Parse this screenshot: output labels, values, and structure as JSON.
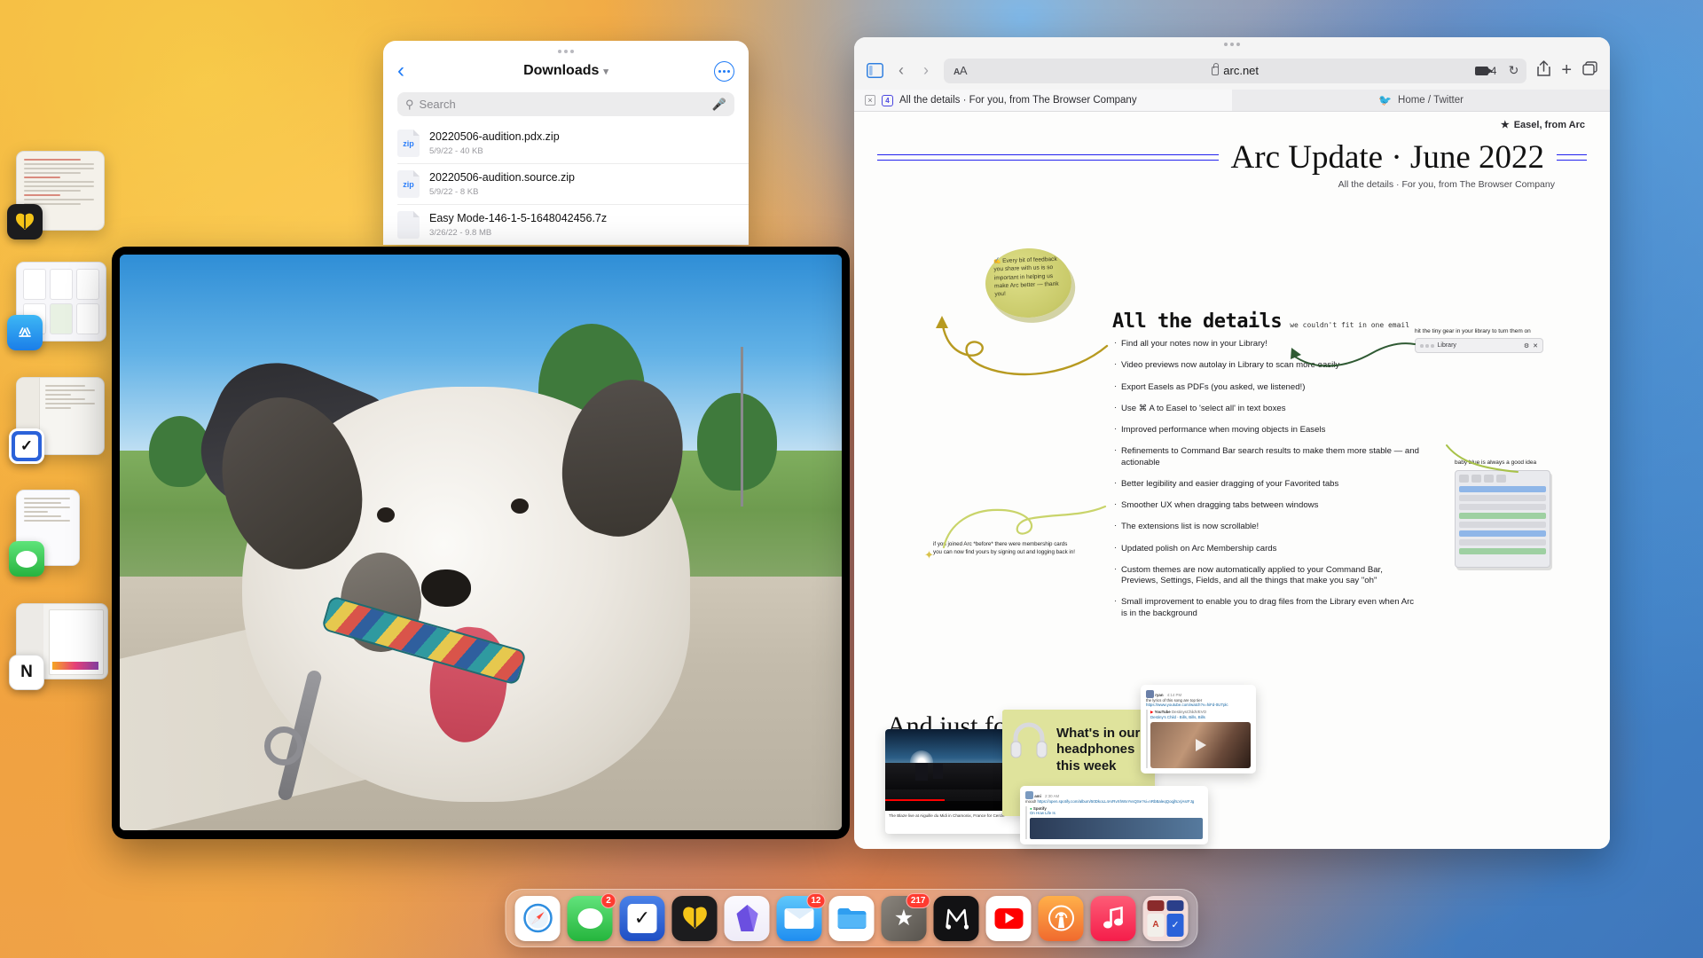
{
  "desktop": {
    "os": "macOS Ventura",
    "stage_manager_items": [
      {
        "name": "bear-document-window",
        "badge_icon": "butterfly-icon",
        "badge_color": "#f5c518"
      },
      {
        "name": "app-store-window",
        "badge_icon": "app-store-icon",
        "badge_color": "#1b8cf0"
      },
      {
        "name": "things-todo-window",
        "badge_icon": "checkmark-icon",
        "badge_color": "#2b62d9"
      },
      {
        "name": "messages-window",
        "badge_icon": "message-bubble-icon",
        "badge_color": "#3ecc5f"
      },
      {
        "name": "notion-window",
        "badge_icon": "notion-icon",
        "badge_color": "#ffffff"
      }
    ]
  },
  "files_window": {
    "back_label": "‹",
    "title": "Downloads",
    "title_chevron": "▾",
    "more_label": "···",
    "search": {
      "placeholder": "Search",
      "value": "",
      "icon": "search-icon",
      "mic_icon": "microphone-icon"
    },
    "files": [
      {
        "name": "20220506-audition.pdx.zip",
        "meta": "5/9/22 - 40 KB",
        "kind": "zip"
      },
      {
        "name": "20220506-audition.source.zip",
        "meta": "5/9/22 - 8 KB",
        "kind": "zip"
      },
      {
        "name": "Easy Mode-146-1-5-1648042456.7z",
        "meta": "3/26/22 - 9.8 MB",
        "kind": "7z"
      }
    ]
  },
  "browser": {
    "toolbar": {
      "sidebar_icon": "sidebar-toggle-icon",
      "back_label": "‹",
      "forward_label": "›",
      "text_size_label": "A",
      "text_size_label_big": "A",
      "domain": "arc.net",
      "lock_icon": "lock-icon",
      "camera_icon": "camera-icon",
      "camera_count": "4",
      "reload_icon": "↻",
      "share_icon": "↑",
      "new_tab_icon": "+",
      "tabs_icon": "⧉"
    },
    "tabs": [
      {
        "title": "All the details · For you, from The Browser Company",
        "favicon": "arc-icon",
        "active": true,
        "close_icon": "×"
      },
      {
        "title": "Home / Twitter",
        "favicon": "twitter-icon",
        "active": false
      }
    ]
  },
  "newsletter": {
    "easel_badge": "Easel, from Arc",
    "title": "Arc Update · June 2022",
    "subtitle": "All the details · For you, from The Browser Company",
    "sticky_note": "✍ Every bit of feedback you share with us is so important in helping us make Arc better — thank you!",
    "section_heading": "All the details",
    "section_heading_note": "we couldn't fit in one email",
    "bullets": [
      "Find all your notes now in your Library!",
      "Video previews now autolay in Library to scan more easily",
      "Export Easels as PDFs (you asked, we listened!)",
      "Use ⌘ A to Easel to 'select all' in text boxes",
      "Improved performance when moving objects in Easels",
      "Refinements to Command Bar search results to make them more stable — and actionable",
      "Better legibility and easier dragging of your Favorited tabs",
      "Smoother UX when dragging tabs between windows",
      "The extensions list is now scrollable!",
      "Updated polish on Arc Membership cards",
      "Custom themes are now automatically applied to your Command Bar, Previews, Settings, Fields, and all the things that make you say \"oh\"",
      "Small improvement to enable you to drag files from the Library even when Arc is in the background"
    ],
    "library_annotation": "hit the tiny gear in your library to turn them on",
    "library_window_label": "Library",
    "babyblue_annotation": "baby blue is always a good idea",
    "membership_annotation": "if you joined Arc *before* there were membership cards you can now find yours by signing out and logging back in!",
    "fun_heading": "And just for fun",
    "media": {
      "youtube_caption": "The Blaze live at Aiguille du Midi in Chamonix, France for Cercle",
      "headphones_heading": "What's in our headphones this week",
      "headphones_icon": "headphones-icon",
      "slack_top": {
        "user": "ryan",
        "time": "4:14 PM",
        "text": "the lyrics of this song are top tier",
        "link": "https://www.youtube.com/watch?v=hiFd-0UTplc",
        "source": "YouTube",
        "source_channel": "DestinysChildVEVO",
        "embed_title": "Destiny's Child - Bills, Bills, Bills"
      },
      "slack_bottom": {
        "user": "ami",
        "time": "2:30 AM",
        "text": "mood!",
        "link": "https://open.spotify.com/album/50DkoLL4ArRvXhWxYvsQSe?si=nRbBaleqQoqjhLVjAsrFJg",
        "source": "Spotify",
        "embed_title": "On How Life Is"
      }
    }
  },
  "dock": {
    "items": [
      {
        "name": "safari",
        "label": "Safari",
        "icon": "compass-icon",
        "bg": "#ffffff",
        "badge": null
      },
      {
        "name": "messages",
        "label": "Messages",
        "icon": "message-bubble-icon",
        "bg": "#3ecc5f",
        "badge": "2"
      },
      {
        "name": "things",
        "label": "Things",
        "icon": "checkmark-icon",
        "bg": "#2b62d9",
        "badge": null
      },
      {
        "name": "bear",
        "label": "Bear",
        "icon": "butterfly-icon",
        "bg": "#1c1c1e",
        "badge": null
      },
      {
        "name": "craft",
        "label": "Craft",
        "icon": "crystal-icon",
        "bg": "#f3f1f8",
        "badge": null
      },
      {
        "name": "mail",
        "label": "Mail",
        "icon": "envelope-icon",
        "bg": "#35a8f7",
        "badge": "12"
      },
      {
        "name": "finder",
        "label": "Finder",
        "icon": "folder-icon",
        "bg": "#ffffff",
        "badge": null
      },
      {
        "name": "reeder",
        "label": "Reeder",
        "icon": "star-icon",
        "bg": "#6e6a64",
        "badge": "217"
      },
      {
        "name": "mimestream",
        "label": "Mimestream",
        "icon": "m-letter-icon",
        "bg": "#111111",
        "badge": null
      },
      {
        "name": "youtube",
        "label": "YouTube",
        "icon": "play-icon",
        "bg": "#ffffff",
        "badge": null
      },
      {
        "name": "podcasts",
        "label": "Podcasts",
        "icon": "broadcast-icon",
        "bg": "#f97a3d",
        "badge": null
      },
      {
        "name": "music",
        "label": "Music",
        "icon": "music-note-icon",
        "bg": "#fa3a5c",
        "badge": null
      },
      {
        "name": "folder-stack",
        "label": "Other",
        "icon": "app-grid-icon",
        "bg": "#f2ddda",
        "badge": null
      }
    ]
  }
}
